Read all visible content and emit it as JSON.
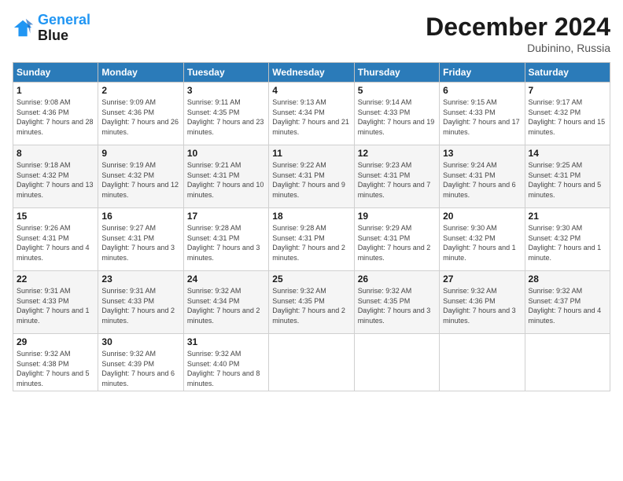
{
  "header": {
    "logo_line1": "General",
    "logo_line2": "Blue",
    "month": "December 2024",
    "location": "Dubinino, Russia"
  },
  "days_of_week": [
    "Sunday",
    "Monday",
    "Tuesday",
    "Wednesday",
    "Thursday",
    "Friday",
    "Saturday"
  ],
  "weeks": [
    [
      {
        "day": "1",
        "sunrise": "9:08 AM",
        "sunset": "4:36 PM",
        "daylight": "7 hours and 28 minutes."
      },
      {
        "day": "2",
        "sunrise": "9:09 AM",
        "sunset": "4:36 PM",
        "daylight": "7 hours and 26 minutes."
      },
      {
        "day": "3",
        "sunrise": "9:11 AM",
        "sunset": "4:35 PM",
        "daylight": "7 hours and 23 minutes."
      },
      {
        "day": "4",
        "sunrise": "9:13 AM",
        "sunset": "4:34 PM",
        "daylight": "7 hours and 21 minutes."
      },
      {
        "day": "5",
        "sunrise": "9:14 AM",
        "sunset": "4:33 PM",
        "daylight": "7 hours and 19 minutes."
      },
      {
        "day": "6",
        "sunrise": "9:15 AM",
        "sunset": "4:33 PM",
        "daylight": "7 hours and 17 minutes."
      },
      {
        "day": "7",
        "sunrise": "9:17 AM",
        "sunset": "4:32 PM",
        "daylight": "7 hours and 15 minutes."
      }
    ],
    [
      {
        "day": "8",
        "sunrise": "9:18 AM",
        "sunset": "4:32 PM",
        "daylight": "7 hours and 13 minutes."
      },
      {
        "day": "9",
        "sunrise": "9:19 AM",
        "sunset": "4:32 PM",
        "daylight": "7 hours and 12 minutes."
      },
      {
        "day": "10",
        "sunrise": "9:21 AM",
        "sunset": "4:31 PM",
        "daylight": "7 hours and 10 minutes."
      },
      {
        "day": "11",
        "sunrise": "9:22 AM",
        "sunset": "4:31 PM",
        "daylight": "7 hours and 9 minutes."
      },
      {
        "day": "12",
        "sunrise": "9:23 AM",
        "sunset": "4:31 PM",
        "daylight": "7 hours and 7 minutes."
      },
      {
        "day": "13",
        "sunrise": "9:24 AM",
        "sunset": "4:31 PM",
        "daylight": "7 hours and 6 minutes."
      },
      {
        "day": "14",
        "sunrise": "9:25 AM",
        "sunset": "4:31 PM",
        "daylight": "7 hours and 5 minutes."
      }
    ],
    [
      {
        "day": "15",
        "sunrise": "9:26 AM",
        "sunset": "4:31 PM",
        "daylight": "7 hours and 4 minutes."
      },
      {
        "day": "16",
        "sunrise": "9:27 AM",
        "sunset": "4:31 PM",
        "daylight": "7 hours and 3 minutes."
      },
      {
        "day": "17",
        "sunrise": "9:28 AM",
        "sunset": "4:31 PM",
        "daylight": "7 hours and 3 minutes."
      },
      {
        "day": "18",
        "sunrise": "9:28 AM",
        "sunset": "4:31 PM",
        "daylight": "7 hours and 2 minutes."
      },
      {
        "day": "19",
        "sunrise": "9:29 AM",
        "sunset": "4:31 PM",
        "daylight": "7 hours and 2 minutes."
      },
      {
        "day": "20",
        "sunrise": "9:30 AM",
        "sunset": "4:32 PM",
        "daylight": "7 hours and 1 minute."
      },
      {
        "day": "21",
        "sunrise": "9:30 AM",
        "sunset": "4:32 PM",
        "daylight": "7 hours and 1 minute."
      }
    ],
    [
      {
        "day": "22",
        "sunrise": "9:31 AM",
        "sunset": "4:33 PM",
        "daylight": "7 hours and 1 minute."
      },
      {
        "day": "23",
        "sunrise": "9:31 AM",
        "sunset": "4:33 PM",
        "daylight": "7 hours and 2 minutes."
      },
      {
        "day": "24",
        "sunrise": "9:32 AM",
        "sunset": "4:34 PM",
        "daylight": "7 hours and 2 minutes."
      },
      {
        "day": "25",
        "sunrise": "9:32 AM",
        "sunset": "4:35 PM",
        "daylight": "7 hours and 2 minutes."
      },
      {
        "day": "26",
        "sunrise": "9:32 AM",
        "sunset": "4:35 PM",
        "daylight": "7 hours and 3 minutes."
      },
      {
        "day": "27",
        "sunrise": "9:32 AM",
        "sunset": "4:36 PM",
        "daylight": "7 hours and 3 minutes."
      },
      {
        "day": "28",
        "sunrise": "9:32 AM",
        "sunset": "4:37 PM",
        "daylight": "7 hours and 4 minutes."
      }
    ],
    [
      {
        "day": "29",
        "sunrise": "9:32 AM",
        "sunset": "4:38 PM",
        "daylight": "7 hours and 5 minutes."
      },
      {
        "day": "30",
        "sunrise": "9:32 AM",
        "sunset": "4:39 PM",
        "daylight": "7 hours and 6 minutes."
      },
      {
        "day": "31",
        "sunrise": "9:32 AM",
        "sunset": "4:40 PM",
        "daylight": "7 hours and 8 minutes."
      },
      null,
      null,
      null,
      null
    ]
  ]
}
